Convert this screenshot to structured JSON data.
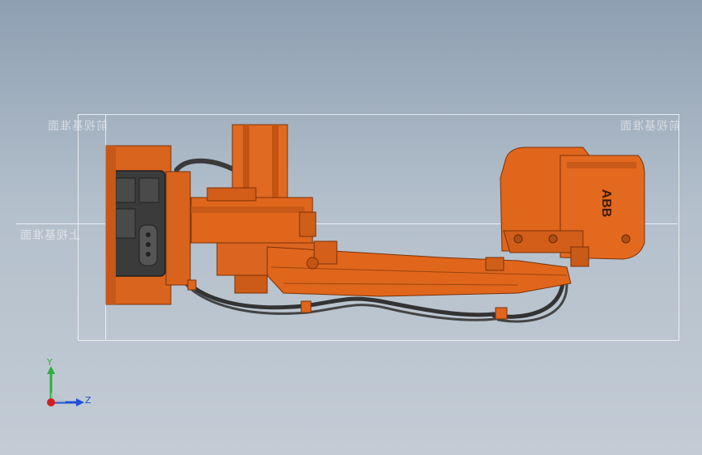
{
  "viewport": {
    "plane_labels": {
      "front_left": "前视基准面",
      "front_right": "前视基准面",
      "top": "上视基准面"
    },
    "logo_text": "ABB",
    "triad": {
      "y_label": "Y",
      "z_label": "Z"
    },
    "colors": {
      "robot_orange": "#e0661c",
      "robot_dark": "#2f2f2f",
      "cable": "#3a3a3a",
      "triad_y": "#2fae3a",
      "triad_z": "#1f4ed8",
      "triad_x": "#d11f1f"
    }
  }
}
